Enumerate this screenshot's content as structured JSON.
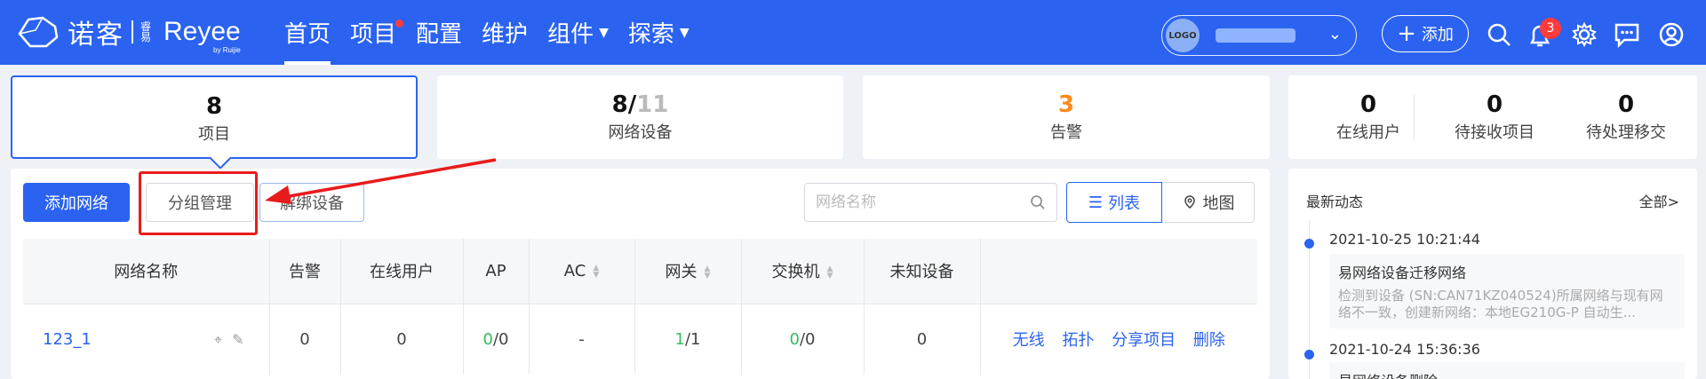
{
  "header": {
    "brand_cn": "诺客",
    "brand_sub": "睿易",
    "brand_en": "Reyee",
    "brand_by": "by Ruijie",
    "nav": [
      {
        "label": "首页",
        "active": true
      },
      {
        "label": "项目",
        "dot": true
      },
      {
        "label": "配置"
      },
      {
        "label": "维护"
      },
      {
        "label": "组件",
        "dropdown": true
      },
      {
        "label": "探索",
        "dropdown": true
      }
    ],
    "org_avatar": "LOGO",
    "add_label": "添加",
    "notification_count": "3",
    "icons": [
      "search-icon",
      "bell-icon",
      "gear-icon",
      "message-icon",
      "user-icon"
    ]
  },
  "stats": {
    "projects": {
      "value": "8",
      "label": "项目"
    },
    "devices": {
      "online": "8",
      "sep": "/",
      "total": "11",
      "label": "网络设备"
    },
    "alarms": {
      "value": "3",
      "label": "告警"
    },
    "online_users": {
      "value": "0",
      "label": "在线用户"
    },
    "pending_receive": {
      "value": "0",
      "label": "待接收项目"
    },
    "pending_transfer": {
      "value": "0",
      "label": "待处理移交"
    }
  },
  "toolbar": {
    "add_network": "添加网络",
    "group_manage": "分组管理",
    "unbind": "解绑设备",
    "search_placeholder": "网络名称",
    "view_list": "列表",
    "view_map": "地图"
  },
  "table": {
    "columns": [
      "网络名称",
      "告警",
      "在线用户",
      "AP",
      "AC",
      "网关",
      "交换机",
      "未知设备",
      ""
    ],
    "rows": [
      {
        "name": "123_1",
        "alarm": "0",
        "online_users": "0",
        "ap_online": "0",
        "ap_total": "/0",
        "ac": "-",
        "gw_online": "1",
        "gw_total": "/1",
        "sw_online": "0",
        "sw_total": "/0",
        "unknown": "0",
        "ops": [
          "无线",
          "拓扑",
          "分享项目",
          "删除"
        ]
      }
    ]
  },
  "news": {
    "title": "最新动态",
    "all": "全部>",
    "items": [
      {
        "time": "2021-10-25 10:21:44",
        "headline": "易网络设备迁移网络",
        "detail": "检测到设备 (SN:CAN71KZ040524)所属网络与现有网络不一致，创建新网络：本地EG210G-P 自动生..."
      },
      {
        "time": "2021-10-24 15:36:36",
        "headline": "易网络设备删除"
      }
    ]
  },
  "colors": {
    "brand": "#2b63f0",
    "alert": "#ff3b3b",
    "orange": "#ff8a1c",
    "green": "#3cb95f"
  }
}
